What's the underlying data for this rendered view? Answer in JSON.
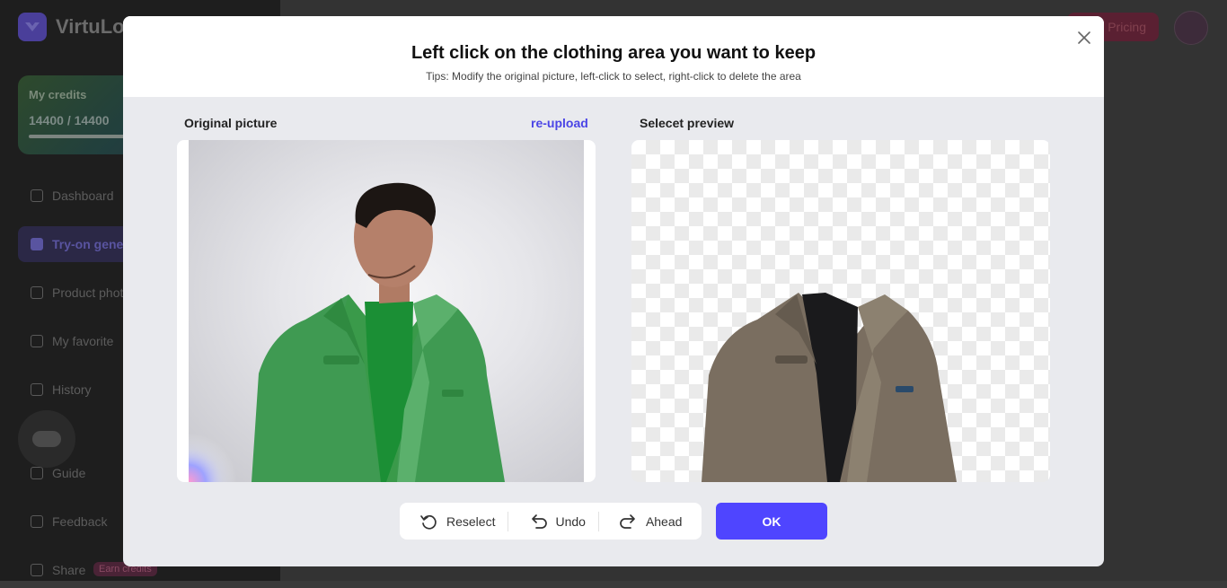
{
  "background_app": {
    "logo_text": "VirtuLook",
    "credits": {
      "title": "My credits",
      "value": "14400 / 14400"
    },
    "nav": [
      {
        "label": "Dashboard"
      },
      {
        "label": "Try-on generation"
      },
      {
        "label": "Product photo"
      },
      {
        "label": "My favorite"
      },
      {
        "label": "History"
      },
      {
        "label": "Guide"
      },
      {
        "label": "Feedback"
      },
      {
        "label": "Share"
      }
    ],
    "earn_badge": "Earn credits",
    "pricing_label": "Pricing"
  },
  "modal": {
    "title": "Left click on the clothing area you want to keep",
    "subtitle": "Tips: Modify the original picture, left-click to select, right-click to delete the area",
    "original_label": "Original picture",
    "reupload_label": "re-upload",
    "preview_label": "Selecet preview",
    "toolbar": {
      "reselect": "Reselect",
      "undo": "Undo",
      "ahead": "Ahead"
    },
    "ok_label": "OK"
  },
  "colors": {
    "accent": "#4f45ff",
    "link": "#4b45e6",
    "jacket_original": "#3a9a4a",
    "jacket_preview": "#7a6e60"
  },
  "icons": [
    "logo-icon",
    "close-icon",
    "reselect-icon",
    "undo-icon",
    "ahead-icon",
    "chat-icon"
  ]
}
